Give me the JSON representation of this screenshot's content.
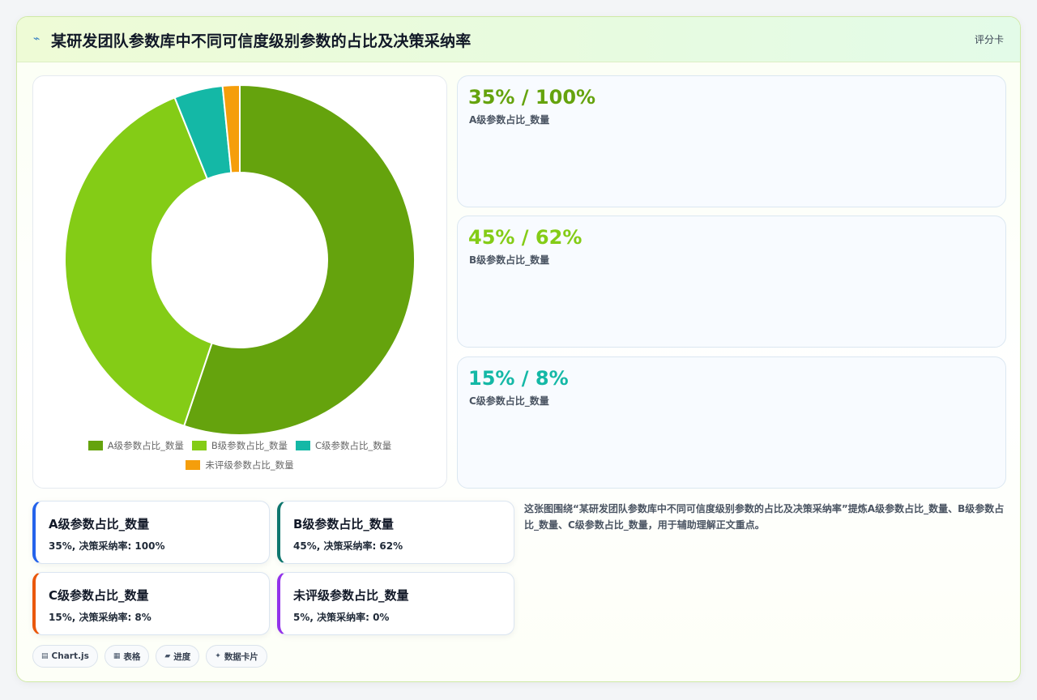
{
  "header": {
    "icon": "bolt-icon",
    "title": "某研发团队参数库中不同可信度级别参数的占比及决策采纳率",
    "tag": "评分卡"
  },
  "chart_data": {
    "type": "pie",
    "variant": "doughnut",
    "categories": [
      "A级参数占比_数量",
      "B级参数占比_数量",
      "C级参数占比_数量",
      "未评级参数占比_数量"
    ],
    "values": [
      35,
      45,
      15,
      5
    ],
    "adoption_rates": [
      100,
      62,
      8,
      0
    ],
    "colors": [
      "#65a30d",
      "#84cc16",
      "#14b8a6",
      "#f59e0b"
    ],
    "rendered_weights": [
      35,
      24.6,
      2.85,
      1
    ],
    "legend_position": "bottom"
  },
  "kpis": [
    {
      "value": "35% / 100%",
      "label": "A级参数占比_数量",
      "color": "#65a30d"
    },
    {
      "value": "45% / 62%",
      "label": "B级参数占比_数量",
      "color": "#84cc16"
    },
    {
      "value": "15% / 8%",
      "label": "C级参数占比_数量",
      "color": "#14b8a6"
    }
  ],
  "minis": [
    {
      "title": "A级参数占比_数量",
      "detail": "35%, 决策采纳率: 100%",
      "accent": "#2563eb"
    },
    {
      "title": "B级参数占比_数量",
      "detail": "45%, 决策采纳率: 62%",
      "accent": "#0f766e"
    },
    {
      "title": "C级参数占比_数量",
      "detail": "15%, 决策采纳率: 8%",
      "accent": "#ea580c"
    },
    {
      "title": "未评级参数占比_数量",
      "detail": "5%, 决策采纳率: 0%",
      "accent": "#9333ea"
    }
  ],
  "description": "这张图围绕“某研发团队参数库中不同可信度级别参数的占比及决策采纳率”提炼A级参数占比_数量、B级参数占比_数量、C级参数占比_数量，用于辅助理解正文重点。",
  "chips": [
    {
      "icon": "image-icon",
      "glyph": "▤",
      "label": "Chart.js"
    },
    {
      "icon": "table-icon",
      "glyph": "▦",
      "label": "表格"
    },
    {
      "icon": "folder-icon",
      "glyph": "▰",
      "label": "进度"
    },
    {
      "icon": "sparkle-icon",
      "glyph": "✦",
      "label": "数据卡片"
    }
  ]
}
